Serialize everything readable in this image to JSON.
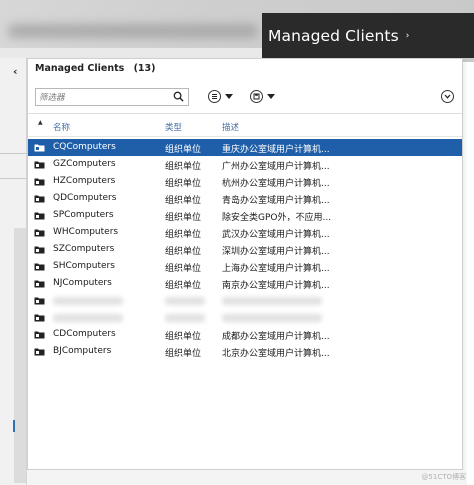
{
  "breadcrumb": {
    "title": "Managed Clients",
    "chevron": "›"
  },
  "nav": {
    "back": "‹"
  },
  "panel": {
    "title": "Managed Clients",
    "count": "(13)",
    "search_placeholder": "筛选器",
    "toolbar": {
      "list_icon": "list-icon",
      "save_icon": "save-icon",
      "expand_icon": "chevron-down-icon"
    }
  },
  "columns": {
    "name": "名称",
    "type": "类型",
    "desc": "描述"
  },
  "rows": [
    {
      "name": "CQComputers",
      "type": "组织单位",
      "desc": "重庆办公室域用户计算机...",
      "selected": true
    },
    {
      "name": "GZComputers",
      "type": "组织单位",
      "desc": "广州办公室域用户计算机..."
    },
    {
      "name": "HZComputers",
      "type": "组织单位",
      "desc": "杭州办公室域用户计算机..."
    },
    {
      "name": "QDComputers",
      "type": "组织单位",
      "desc": "青岛办公室域用户计算机..."
    },
    {
      "name": "SPComputers",
      "type": "组织单位",
      "desc": "除安全类GPO外，不应用..."
    },
    {
      "name": "WHComputers",
      "type": "组织单位",
      "desc": "武汉办公室域用户计算机..."
    },
    {
      "name": "SZComputers",
      "type": "组织单位",
      "desc": "深圳办公室域用户计算机..."
    },
    {
      "name": "SHComputers",
      "type": "组织单位",
      "desc": "上海办公室域用户计算机..."
    },
    {
      "name": "NJComputers",
      "type": "组织单位",
      "desc": "南京办公室域用户计算机..."
    },
    {
      "name": "",
      "type": "",
      "desc": "",
      "blurred": true
    },
    {
      "name": "",
      "type": "",
      "desc": "",
      "blurred": true
    },
    {
      "name": "CDComputers",
      "type": "组织单位",
      "desc": "成都办公室域用户计算机..."
    },
    {
      "name": "BJComputers",
      "type": "组织单位",
      "desc": "北京办公室域用户计算机..."
    }
  ],
  "watermark": "@51CTO博客"
}
